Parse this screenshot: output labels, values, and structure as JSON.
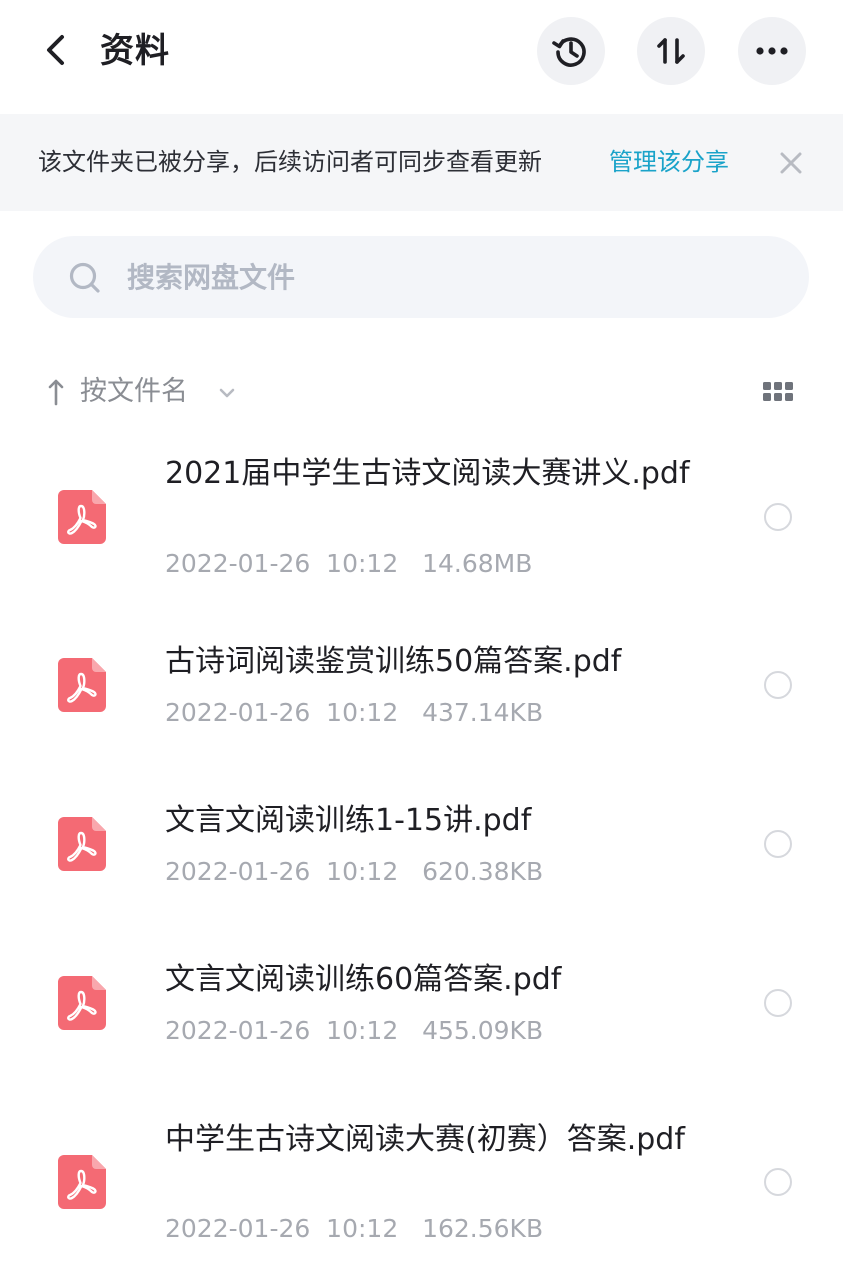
{
  "header": {
    "title": "资料",
    "icons": {
      "back": "chevron-left-icon",
      "history": "history-icon",
      "sort": "sort-arrows-icon",
      "more": "more-horizontal-icon"
    }
  },
  "share_banner": {
    "text": "该文件夹已被分享，后续访问者可同步查看更新",
    "link": "管理该分享",
    "link_color": "#1aa3c9"
  },
  "search": {
    "placeholder": "搜索网盘文件"
  },
  "sort": {
    "label": "按文件名",
    "direction": "ascending"
  },
  "files": [
    {
      "name": "2021届中学生古诗文阅读大赛讲义.pdf",
      "meta": "2022-01-26  10:12   14.68MB",
      "type": "pdf"
    },
    {
      "name": "古诗词阅读鉴赏训练50篇答案.pdf",
      "meta": "2022-01-26  10:12   437.14KB",
      "type": "pdf"
    },
    {
      "name": "文言文阅读训练1-15讲.pdf",
      "meta": "2022-01-26  10:12   620.38KB",
      "type": "pdf"
    },
    {
      "name": "文言文阅读训练60篇答案.pdf",
      "meta": "2022-01-26  10:12   455.09KB",
      "type": "pdf"
    },
    {
      "name": "中学生古诗文阅读大赛(初赛）答案.pdf",
      "meta": "2022-01-26  10:12   162.56KB",
      "type": "pdf"
    }
  ],
  "colors": {
    "pdf_icon": "#f46a74",
    "accent": "#1aa3c9"
  }
}
